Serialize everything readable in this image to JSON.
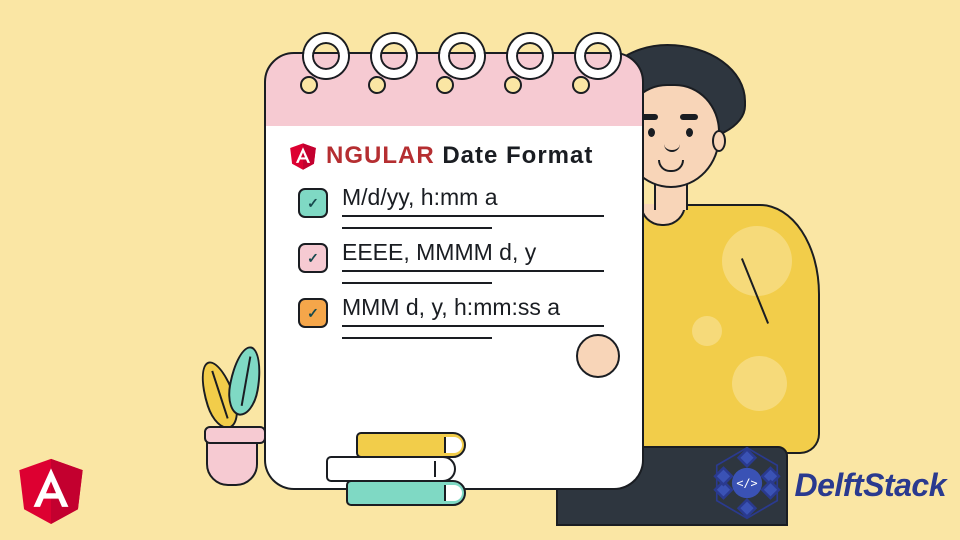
{
  "title": {
    "angular_prefix_letter": "A",
    "angular_rest": "NGULAR",
    "suffix": " Date Format"
  },
  "items": [
    {
      "text": "M/d/yy, h:mm a",
      "color": "g"
    },
    {
      "text": "EEEE, MMMM d, y",
      "color": "p"
    },
    {
      "text": "MMM d, y, h:mm:ss a",
      "color": "o"
    }
  ],
  "brand": {
    "name": "DelftStack"
  },
  "colors": {
    "bg": "#fae6a4",
    "angular_red": "#dd0031",
    "angular_dark": "#c3002f",
    "delft_blue": "#2a3a8f"
  },
  "icons": {
    "angular": "angular-shield-icon",
    "check": "checkmark-icon",
    "delft": "delftstack-logo-icon"
  }
}
